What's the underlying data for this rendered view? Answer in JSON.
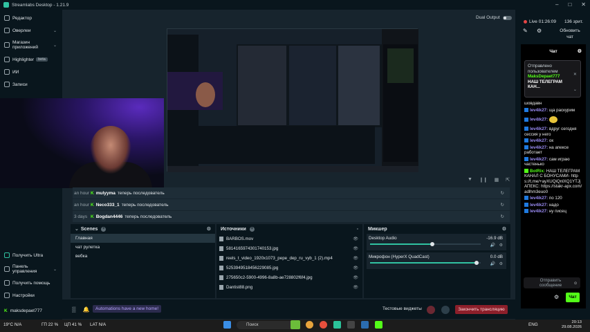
{
  "app": {
    "title": "Streamlabs Desktop - 1.21.9"
  },
  "sidebar": {
    "items": [
      {
        "label": "Редактор"
      },
      {
        "label": "Оверлеи"
      },
      {
        "label": "Магазин приложений"
      },
      {
        "label": "Highlighter",
        "badge": "beta"
      },
      {
        "label": "ИИ"
      },
      {
        "label": "Записи"
      }
    ],
    "bottom": [
      {
        "label": "Получить Ultra"
      },
      {
        "label": "Панель управления"
      },
      {
        "label": "Получить помощь"
      },
      {
        "label": "Настройки"
      },
      {
        "label": "maksdepaet777"
      }
    ]
  },
  "editor": {
    "dual_output": "Dual Output"
  },
  "events": [
    {
      "time": "an hour",
      "user": "mulyyma",
      "text": "теперь последователь"
    },
    {
      "time": "an hour",
      "user": "Neco333_1",
      "text": "теперь последователь"
    },
    {
      "time": "3 days",
      "user": "Bogdan4446",
      "text": "теперь последователь"
    }
  ],
  "scenes": {
    "title": "Scenes",
    "items": [
      "Главная",
      "чат рулетка",
      "вебка"
    ]
  },
  "sources": {
    "title": "Источники",
    "items": [
      "BARBOS.mov",
      "5814165974301740153.jpg",
      "reels_t_video_1920x1073_pepe_dep_ru_vyb_1 (2).mp4",
      "5253949518456229085.jpg",
      "275650c2-5900-4996-8a8b-ae728802f6f4.jpg",
      "Dantist88.png"
    ]
  },
  "mixer": {
    "title": "Микшер",
    "items": [
      {
        "name": "Desktop Audio",
        "db": "-16.9 dB",
        "level": 0.56
      },
      {
        "name": "Микрофон (HyperX QuadCast)",
        "db": "0.0 dB",
        "level": 0.96
      }
    ]
  },
  "footer": {
    "automation": "Automations have a new home!",
    "test_widgets": "Тестовые виджеты",
    "end_stream": "Закончить трансляцию"
  },
  "right": {
    "live": "Live 01:26:09",
    "viewers": "136 зрит.",
    "refresh": "Обновить чат",
    "chat_title": "Чат",
    "pinned": {
      "header": "Отправлено пользователем",
      "user": "MaksDepaet777",
      "text": "НАШ ТЕЛЕГРАМ КАН..."
    },
    "messages": [
      {
        "user": "",
        "text": "шовдавн"
      },
      {
        "user": "lev4ik27:",
        "text": "ща раскурим"
      },
      {
        "user": "lev4ik27:",
        "text": ""
      },
      {
        "user": "lev4ik27:",
        "text": "вдруг сегодня сессия у него"
      },
      {
        "user": "lev4ik27:",
        "text": "ок"
      },
      {
        "user": "lev4ik27:",
        "text": "на апексе работает"
      },
      {
        "user": "lev4ik27:",
        "text": "сам играю частенько"
      },
      {
        "user": "BotRix:",
        "text": "НАШ ТЕЛЕГРАМ КАНАЛ С БОНУСАМИ- https://t.me/+ayXUQiQnlXQ1YTJj АПЕКС: https://stakr-apx.com/adlhm3euo0"
      },
      {
        "user": "lev4ik27:",
        "text": "по 120"
      },
      {
        "user": "lev4ik27:",
        "text": "надо"
      },
      {
        "user": "lev4ik27:",
        "text": "ну писец"
      }
    ],
    "input_placeholder": "Отправить сообщение",
    "send": "Чат"
  },
  "taskbar": {
    "weather_temp": "19°C",
    "weather": "N/A",
    "gpu": "ГП  22 %",
    "cpu": "ЦП  41 %",
    "lat": "LAT  N/A",
    "search": "Поиск",
    "lang": "ENG",
    "time": "20:13",
    "date": "29.08.2026"
  }
}
